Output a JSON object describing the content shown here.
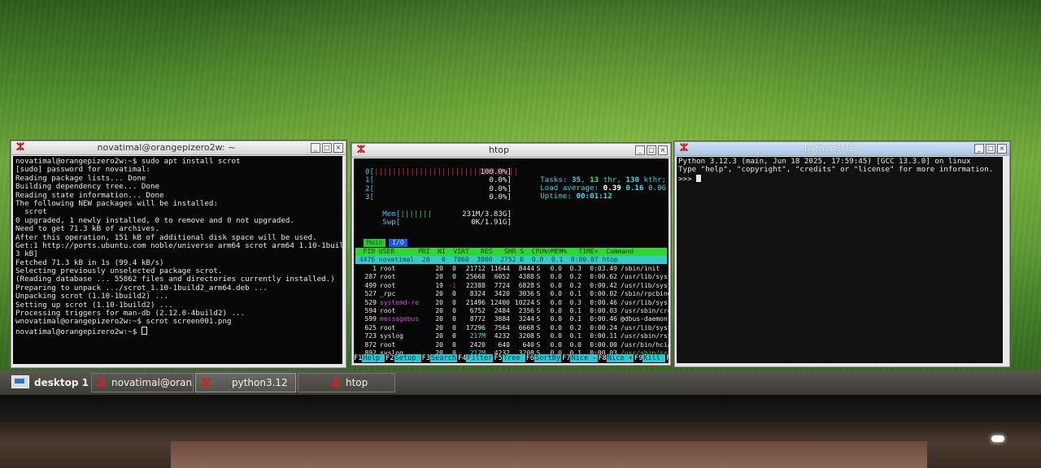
{
  "terminal": {
    "title": "novatimal@orangepizero2w: ~",
    "lines": [
      "novatimal@orangepizero2w:~$ sudo apt install scrot",
      "[sudo] password for novatimal:",
      "Reading package lists... Done",
      "Building dependency tree... Done",
      "Reading state information... Done",
      "The following NEW packages will be installed:",
      "  scrot",
      "0 upgraded, 1 newly installed, 0 to remove and 0 not upgraded.",
      "Need to get 71.3 kB of archives.",
      "After this operation, 151 kB of additional disk space will be used.",
      "Get:1 http://ports.ubuntu.com noble/universe arm64 scrot arm64 1.10-1build2 [71.",
      "3 kB]",
      "Fetched 71.3 kB in 1s (99.4 kB/s)",
      "Selecting previously unselected package scrot.",
      "(Reading database ... 55862 files and directories currently installed.)",
      "Preparing to unpack .../scrot_1.10-1build2_arm64.deb ...",
      "Unpacking scrot (1.10-1build2) ...",
      "Setting up scrot (1.10-1build2) ...",
      "Processing triggers for man-db (2.12.0-4build2) ...",
      "wnovatimal@orangepizero2w:~$ scrot screen001.png",
      "novatimal@orangepizero2w:~$ "
    ]
  },
  "htop": {
    "title": "htop",
    "cpus": [
      {
        "label": "0[",
        "bar": "||||||||||||||||||||||||||||||||",
        "value": "100.0%]",
        "level": 1.0
      },
      {
        "label": "1[",
        "bar": "",
        "value": "0.0%]",
        "level": 0
      },
      {
        "label": "2[",
        "bar": "",
        "value": "0.0%]",
        "level": 0
      },
      {
        "label": "3[",
        "bar": "",
        "value": "0.0%]",
        "level": 0
      }
    ],
    "mem": {
      "label": "Mem[",
      "bar": "|||||||",
      "value": "231M/3.83G]"
    },
    "swp": {
      "label": "Swp[",
      "bar": "",
      "value": "0K/1.91G]"
    },
    "tasks": {
      "prefix": "Tasks: ",
      "count": "35",
      "sep": ", ",
      "thr": "13",
      "thr_label": " thr, ",
      "kthr": "130",
      "kthr_label": " kthr; ",
      "running": "1",
      "running_label": " running"
    },
    "load": {
      "prefix": "Load average: ",
      "v1": "0.39",
      "v2": "0.16",
      "v3": "0.06"
    },
    "uptime": {
      "prefix": "Uptime: ",
      "value": "00:01:12"
    },
    "tabs": [
      "Main",
      "I/O"
    ],
    "header": "  PID USER      PRI  NI  VIRT   RES   SHR S  CPU%▽MEM%   TIME+  Command",
    "selected": " 4476 novatimal  20   0  7860  3800  2752 R  0.0  0.1  0:00.07 htop",
    "rows": [
      {
        "pid": "1",
        "user": "root",
        "pri": "20",
        "ni": "0",
        "virt": "21712",
        "res": "11644",
        "shr": "8444",
        "s": "S",
        "cpu": "0.0",
        "mem": "0.3",
        "time": "0:03.49",
        "cmd": "/sbin/init",
        "user_class": "",
        "cmd_class": ""
      },
      {
        "pid": "287",
        "user": "root",
        "pri": "20",
        "ni": "0",
        "virt": "25668",
        "res": "6052",
        "shr": "4388",
        "s": "S",
        "cpu": "0.0",
        "mem": "0.2",
        "time": "0:00.62",
        "cmd": "/usr/lib/syst",
        "user_class": "",
        "cmd_class": ""
      },
      {
        "pid": "499",
        "user": "root",
        "pri": "19",
        "ni": "-1",
        "virt": "22388",
        "res": "7724",
        "shr": "6828",
        "s": "S",
        "cpu": "0.0",
        "mem": "0.2",
        "time": "0:00.42",
        "cmd": "/usr/lib/syst",
        "user_class": "",
        "cmd_class": ""
      },
      {
        "pid": "527",
        "user": "_rpc",
        "pri": "20",
        "ni": "0",
        "virt": "8324",
        "res": "3420",
        "shr": "3036",
        "s": "S",
        "cpu": "0.0",
        "mem": "0.1",
        "time": "0:00.02",
        "cmd": "/sbin/rpcbind",
        "user_class": "",
        "cmd_class": ""
      },
      {
        "pid": "529",
        "user": "systemd-re",
        "pri": "20",
        "ni": "0",
        "virt": "21496",
        "res": "12400",
        "shr": "10224",
        "s": "S",
        "cpu": "0.0",
        "mem": "0.3",
        "time": "0:00.46",
        "cmd": "/usr/lib/syst",
        "user_class": "magenta",
        "cmd_class": ""
      },
      {
        "pid": "594",
        "user": "root",
        "pri": "20",
        "ni": "0",
        "virt": "6752",
        "res": "2484",
        "shr": "2356",
        "s": "S",
        "cpu": "0.0",
        "mem": "0.1",
        "time": "0:00.03",
        "cmd": "/usr/sbin/cro",
        "user_class": "",
        "cmd_class": ""
      },
      {
        "pid": "599",
        "user": "messagebus",
        "pri": "20",
        "ni": "0",
        "virt": "8772",
        "res": "3884",
        "shr": "3244",
        "s": "S",
        "cpu": "0.0",
        "mem": "0.1",
        "time": "0:00.46",
        "cmd": "@dbus-daemon",
        "user_class": "magenta",
        "cmd_class": ""
      },
      {
        "pid": "625",
        "user": "root",
        "pri": "20",
        "ni": "0",
        "virt": "17296",
        "res": "7564",
        "shr": "6668",
        "s": "S",
        "cpu": "0.0",
        "mem": "0.2",
        "time": "0:00.24",
        "cmd": "/usr/lib/syst",
        "user_class": "",
        "cmd_class": ""
      },
      {
        "pid": "723",
        "user": "syslog",
        "pri": "20",
        "ni": "0",
        "virt": "217M",
        "res": "4232",
        "shr": "3208",
        "s": "S",
        "cpu": "0.0",
        "mem": "0.1",
        "time": "0:00.11",
        "cmd": "/usr/sbin/rsy",
        "user_class": "",
        "cmd_class": ""
      },
      {
        "pid": "872",
        "user": "root",
        "pri": "20",
        "ni": "0",
        "virt": "2420",
        "res": "640",
        "shr": "640",
        "s": "S",
        "cpu": "0.0",
        "mem": "0.0",
        "time": "0:00.00",
        "cmd": "/usr/bin/hcia",
        "user_class": "",
        "cmd_class": ""
      },
      {
        "pid": "892",
        "user": "syslog",
        "pri": "20",
        "ni": "0",
        "virt": "217M",
        "res": "4232",
        "shr": "3208",
        "s": "S",
        "cpu": "0.0",
        "mem": "0.1",
        "time": "0:00.03",
        "cmd": "/usr/sbin/rsy",
        "user_class": "",
        "cmd_class": "green-path"
      },
      {
        "pid": "893",
        "user": "syslog",
        "pri": "20",
        "ni": "0",
        "virt": "217M",
        "res": "4232",
        "shr": "3208",
        "s": "S",
        "cpu": "0.0",
        "mem": "0.1",
        "time": "0:00.00",
        "cmd": "/usr/sbin/rsy",
        "user_class": "",
        "cmd_class": "green-path"
      }
    ],
    "fkeys": [
      {
        "key": "F1",
        "action": "Help  "
      },
      {
        "key": "F2",
        "action": "Setup "
      },
      {
        "key": "F3",
        "action": "Search"
      },
      {
        "key": "F4",
        "action": "Filter"
      },
      {
        "key": "F5",
        "action": "Tree  "
      },
      {
        "key": "F6",
        "action": "SortBy"
      },
      {
        "key": "F7",
        "action": "Nice -"
      },
      {
        "key": "F8",
        "action": "Nice +"
      },
      {
        "key": "F9",
        "action": "Kill  "
      },
      {
        "key": "F10",
        "action": "Quit"
      }
    ]
  },
  "python": {
    "title": "python3.12",
    "lines": [
      "Python 3.12.3 (main, Jun 18 2025, 17:59:45) [GCC 13.3.0] on linux",
      "Type \"help\", \"copyright\", \"credits\" or \"license\" for more information.",
      ">>> "
    ]
  },
  "taskbar": {
    "desktop_label": "desktop 1",
    "tasks": [
      "novatimal@oran...",
      "python3.12",
      "htop"
    ]
  },
  "titlebar_buttons": {
    "minimize": "_",
    "maximize": "□",
    "close": "×"
  },
  "colors": {
    "wallpaper": "#5d9a33",
    "terminal_bg": "#070707",
    "htop_header": "#2fd62f",
    "htop_selected": "#34c8c8",
    "x_logo": "#c0282a"
  }
}
